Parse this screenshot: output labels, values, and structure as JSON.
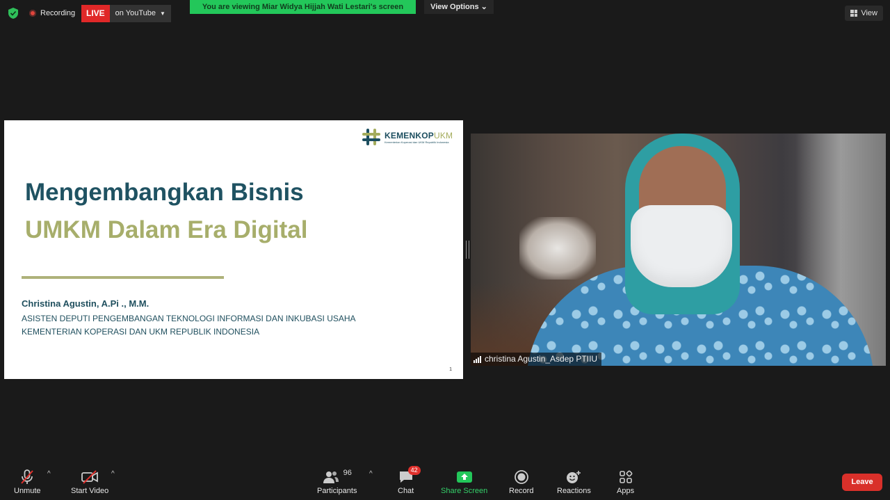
{
  "topbar": {
    "recording_label": "Recording",
    "live_label": "LIVE",
    "live_destination": "on YouTube",
    "viewing_banner": "You are viewing Miar Widya Hijjah Wati Lestari's screen",
    "view_options_label": "View Options",
    "view_label": "View"
  },
  "slide": {
    "logo_name_part1": "KEMENKOP",
    "logo_name_part2": "UKM",
    "logo_subtitle": "Kementerian Koperasi dan UKM Republik Indonesia",
    "title_line1": "Mengembangkan Bisnis",
    "title_line2": "UMKM Dalam Era Digital",
    "presenter": "Christina Agustin, A.Pi ., M.M.",
    "role_line1": "ASISTEN DEPUTI PENGEMBANGAN TEKNOLOGI INFORMASI DAN INKUBASI USAHA",
    "role_line2": "KEMENTERIAN KOPERASI DAN UKM REPUBLIK INDONESIA",
    "page_number": "1"
  },
  "video": {
    "participant_name": "christina Agustin_Asdep PTIIU"
  },
  "toolbar": {
    "unmute": "Unmute",
    "start_video": "Start Video",
    "participants": "Participants",
    "participants_count": "96",
    "chat": "Chat",
    "chat_badge": "42",
    "share_screen": "Share Screen",
    "record": "Record",
    "reactions": "Reactions",
    "apps": "Apps",
    "leave": "Leave"
  },
  "colors": {
    "live_red": "#e02828",
    "share_green": "#23c75a",
    "slide_teal": "#1f5262",
    "slide_olive": "#a7ae6b",
    "leave_red": "#d9302a"
  }
}
